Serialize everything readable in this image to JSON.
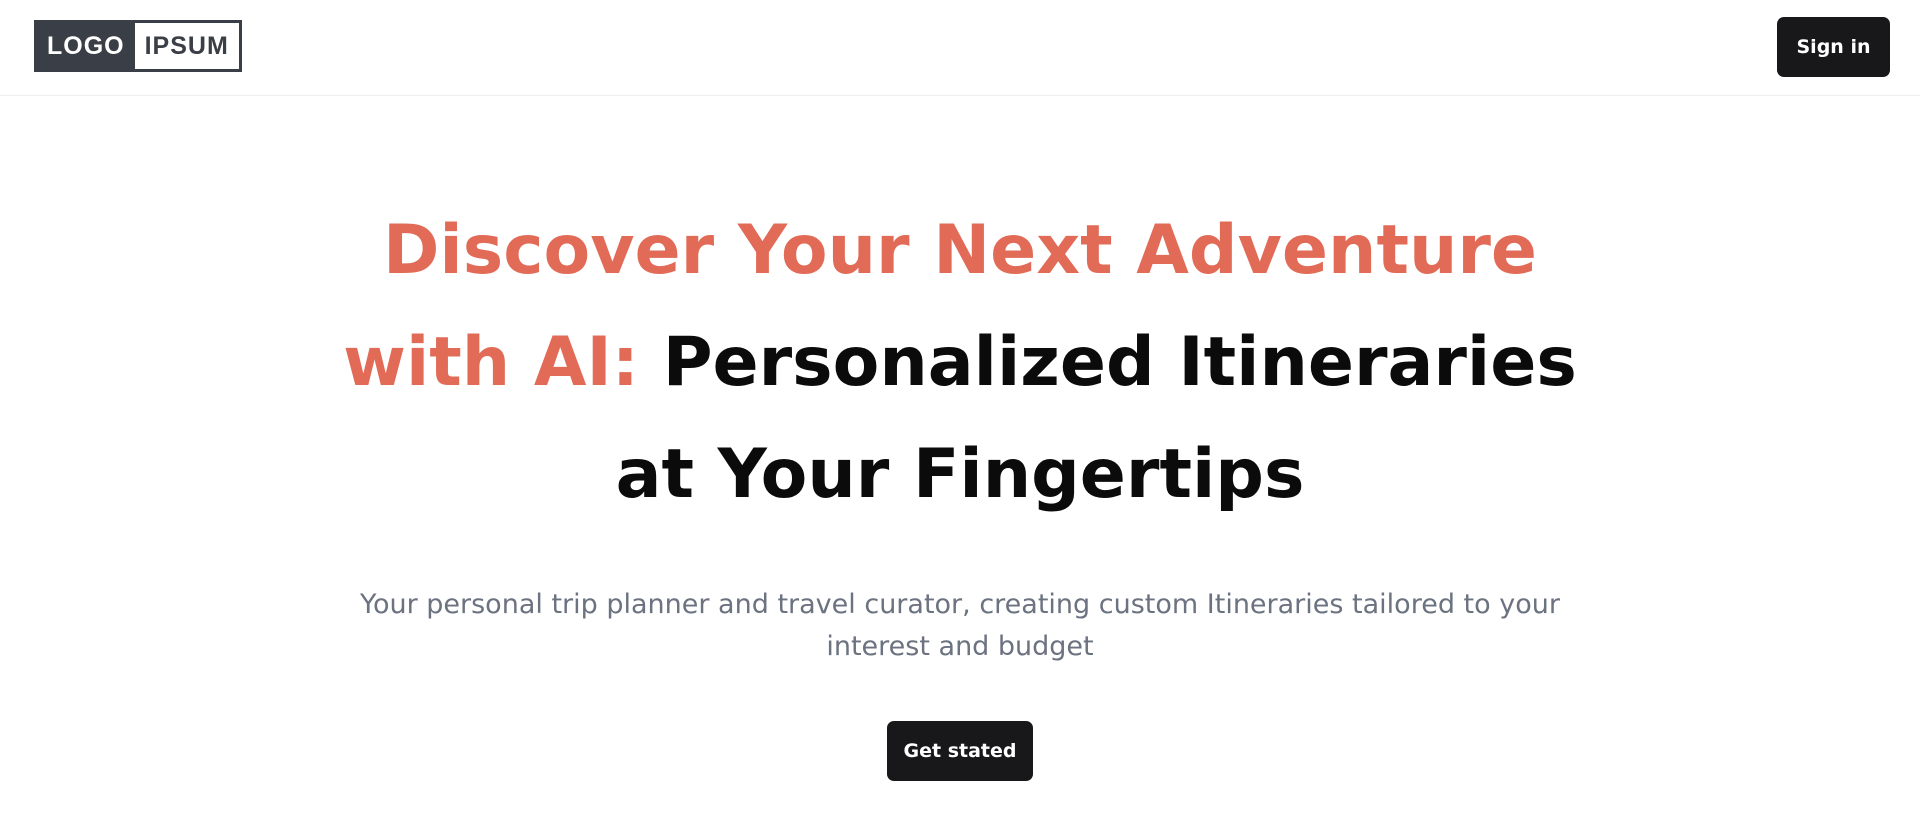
{
  "header": {
    "logo_part1": "LOGO",
    "logo_part2": "IPSUM",
    "signin_label": "Sign in"
  },
  "hero": {
    "title_accent_line1": "Discover Your Next Adventure",
    "title_accent_line2": "with AI:",
    "title_dark_line2": "Personalized Itineraries",
    "title_dark_line3": "at Your Fingertips",
    "subtitle_line1": "Your personal trip planner and travel curator, creating custom Itineraries tailored to your",
    "subtitle_line2": "interest and budget",
    "cta_label": "Get stated"
  },
  "colors": {
    "accent": "#e26b57",
    "dark": "#18181a",
    "muted": "#6b7280",
    "logo": "#3a3f47"
  }
}
